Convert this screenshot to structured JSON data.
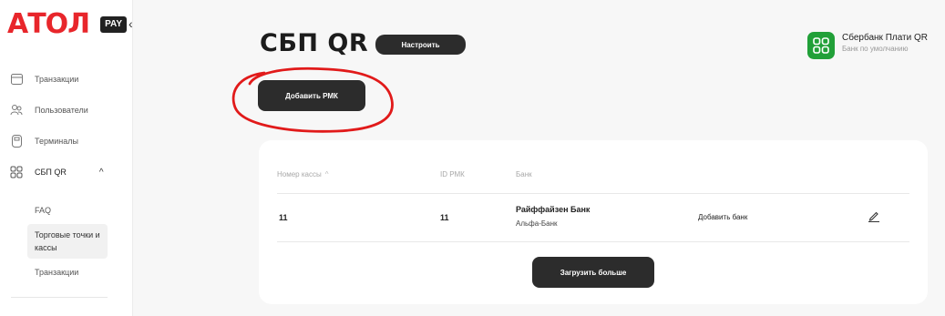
{
  "brand": {
    "logo_text": "АТОЛ",
    "pay_badge": "PAY",
    "collapse_glyph": "‹"
  },
  "sidebar": {
    "items": [
      {
        "label": "Транзакции",
        "icon": "transactions-icon"
      },
      {
        "label": "Пользователи",
        "icon": "users-icon"
      },
      {
        "label": "Терминалы",
        "icon": "terminal-icon"
      },
      {
        "label": "СБП QR",
        "icon": "qr-icon",
        "expanded": true,
        "chevron": "^"
      }
    ],
    "sub_items": [
      {
        "label": "FAQ"
      },
      {
        "label": "Торговые точки и кассы",
        "selected": true
      },
      {
        "label": "Транзакции"
      }
    ]
  },
  "header": {
    "title": "СБП QR",
    "setup_label": "Настроить",
    "add_label": "Добавить РМК"
  },
  "default_bank": {
    "name": "Сбербанк Плати QR",
    "subtitle": "Банк по умолчанию",
    "icon": "sber-qr-icon",
    "color": "#21a038"
  },
  "table": {
    "columns": [
      "Номер кассы",
      "ID РМК",
      "Банк"
    ],
    "sort_glyph": "^",
    "rows": [
      {
        "register_no": "11",
        "pos_id": "11",
        "bank_primary": "Райффайзен Банк",
        "bank_secondary": "Альфа-Банк",
        "add_bank_label": "Добавить банк",
        "edit_icon": "pencil-icon"
      }
    ],
    "load_more_label": "Загрузить больше"
  },
  "colors": {
    "brand_red": "#e8262b",
    "dark_button": "#2c2c2c",
    "annotation": "#e11a1a"
  }
}
